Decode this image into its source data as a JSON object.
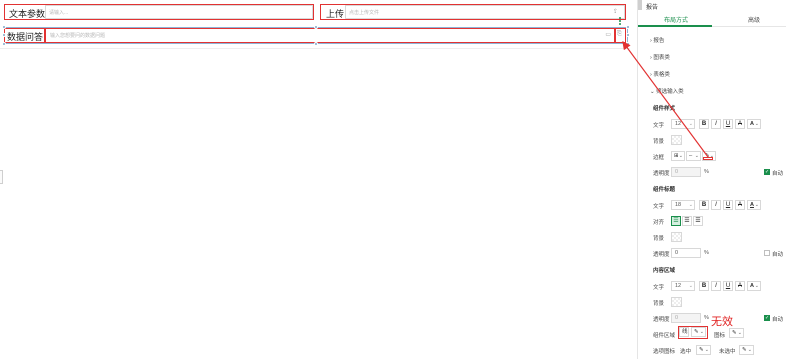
{
  "canvas": {
    "widget1": {
      "label": "文本参数",
      "placeholder": "请输入..."
    },
    "widget2": {
      "label": "上传",
      "placeholder": "点击上传文件"
    },
    "widget3": {
      "label": "数据问答",
      "placeholder": "输入您想要问的数据问题"
    }
  },
  "panel": {
    "title": "报告",
    "tabs": [
      {
        "label": "布局方式",
        "active": true
      },
      {
        "label": "高级",
        "active": false
      }
    ],
    "accordions": [
      "报告",
      "图表类",
      "表格类",
      "筛选输入类"
    ],
    "component_style": {
      "heading": "组件样式",
      "text_label": "文字",
      "text_size": "12",
      "bold": "B",
      "italic": "I",
      "underline": "U",
      "strike": "A",
      "font_color": "A",
      "background_label": "背景",
      "border_label": "边框",
      "transparency_label": "透明度",
      "transparency_value": "0",
      "unit": "%",
      "auto_label": "自动",
      "auto_checked": true
    },
    "component_title": {
      "heading": "组件标题",
      "text_label": "文字",
      "text_size": "18",
      "bold": "B",
      "italic": "I",
      "underline": "U",
      "strike": "A",
      "font_color": "A",
      "align_label": "对齐",
      "background_label": "背景",
      "transparency_label": "透明度",
      "transparency_value": "0",
      "unit": "%",
      "auto_label": "自动",
      "auto_checked": false
    },
    "content_area": {
      "heading": "内容区域",
      "text_label": "文字",
      "text_size": "12",
      "bold": "B",
      "italic": "I",
      "underline": "U",
      "strike": "A",
      "font_color": "A",
      "background_label": "背景",
      "transparency_label": "透明度",
      "transparency_value": "0",
      "unit": "%",
      "auto_label": "自动",
      "auto_checked": true,
      "component_area_label": "组件区域",
      "component_area_value": "线",
      "icon_label": "图标",
      "option_icon_label": "选项图标",
      "selected_label": "选中",
      "unselected_label": "未选中"
    },
    "annotation": "无效"
  },
  "colors": {
    "accent": "#1a8f4c",
    "highlight": "#e23232",
    "selection": "#8fb4d6"
  },
  "icons": [
    "more-vertical-icon",
    "chevron-right-icon",
    "chat-icon",
    "send-icon",
    "upload-icon",
    "pen-icon",
    "check-icon",
    "caret-down-icon"
  ]
}
